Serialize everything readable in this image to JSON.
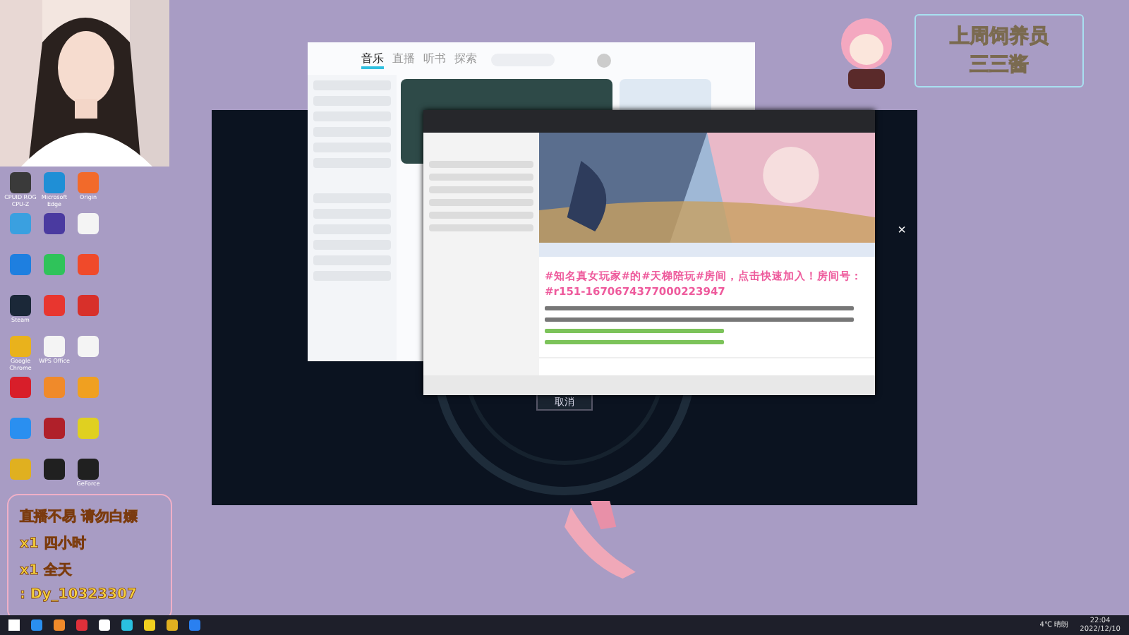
{
  "desktop_icons": [
    {
      "label": "CPUID ROG CPU-Z",
      "color": "#3a3a3a"
    },
    {
      "label": "Microsoft Edge",
      "color": "#1f8fd6"
    },
    {
      "label": "Origin",
      "color": "#f26a2a"
    },
    {
      "color": "#3aa0e0"
    },
    {
      "color": "#4a3aa0"
    },
    {
      "color": "#f4f4f4"
    },
    {
      "color": "#1e7fe0"
    },
    {
      "color": "#2fc35a"
    },
    {
      "color": "#f04a2a"
    },
    {
      "label": "Steam",
      "color": "#1b2838"
    },
    {
      "color": "#e8362f"
    },
    {
      "color": "#d8302a"
    },
    {
      "label": "Google Chrome",
      "color": "#e9b21c"
    },
    {
      "label": "WPS Office",
      "color": "#f4f4f4"
    },
    {
      "color": "#f4f4f4"
    },
    {
      "color": "#d81e2a"
    },
    {
      "color": "#f08a2a"
    },
    {
      "color": "#f0a020"
    },
    {
      "color": "#2a8ff0"
    },
    {
      "color": "#b0202a"
    },
    {
      "color": "#e0d020"
    },
    {
      "color": "#e0b020"
    },
    {
      "color": "#202020"
    },
    {
      "label": "GeForce",
      "color": "#202020"
    }
  ],
  "music_window": {
    "tabs": [
      {
        "label": "音乐",
        "selected": true
      },
      {
        "label": "直播",
        "selected": false
      },
      {
        "label": "听书",
        "selected": false
      },
      {
        "label": "探索",
        "selected": false
      }
    ]
  },
  "dialog": {
    "cancel": "取消",
    "close": "×"
  },
  "chat_window": {
    "room_notice": "#知名真女玩家#的#天梯陪玩#房间，点击快速加入！房间号：#r151-1670674377000223947",
    "notices": [
      {
        "kind": "system"
      },
      {
        "kind": "system"
      },
      {
        "kind": "ad"
      },
      {
        "kind": "ad"
      }
    ]
  },
  "badge": {
    "title": "上周饲养员",
    "name": "三三酱"
  },
  "overlay": {
    "lines": [
      "直播不易 请勿白嫖",
      "x1 四小时",
      "x1 全天",
      ": Dy_10323307"
    ]
  },
  "taskbar": {
    "weather": "4℃ 晴朗",
    "time": "22:04",
    "date": "2022/12/10"
  }
}
